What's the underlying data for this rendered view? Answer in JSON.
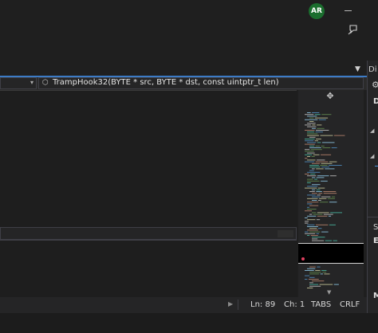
{
  "titlebar": {
    "avatar_initials": "AR",
    "avatar_color": "#1b6e2e"
  },
  "navigation": {
    "member_signature": "TrampHook32(BYTE * src, BYTE * dst, const uintptr_t len)"
  },
  "status": {
    "line": "Ln: 89",
    "column": "Ch: 1",
    "indent": "TABS",
    "line_ending": "CRLF"
  },
  "right_panel": {
    "title": "Di",
    "header_letter": "D",
    "section_letter": "S",
    "item_e": "E",
    "item_m": "M"
  },
  "icons": {
    "feedback": "feedback-icon",
    "member": "cube-icon",
    "split": "split-handle-icon",
    "gear": "gear-icon"
  },
  "colors": {
    "accent": "#3c7bc6",
    "marker": "#e04060"
  }
}
